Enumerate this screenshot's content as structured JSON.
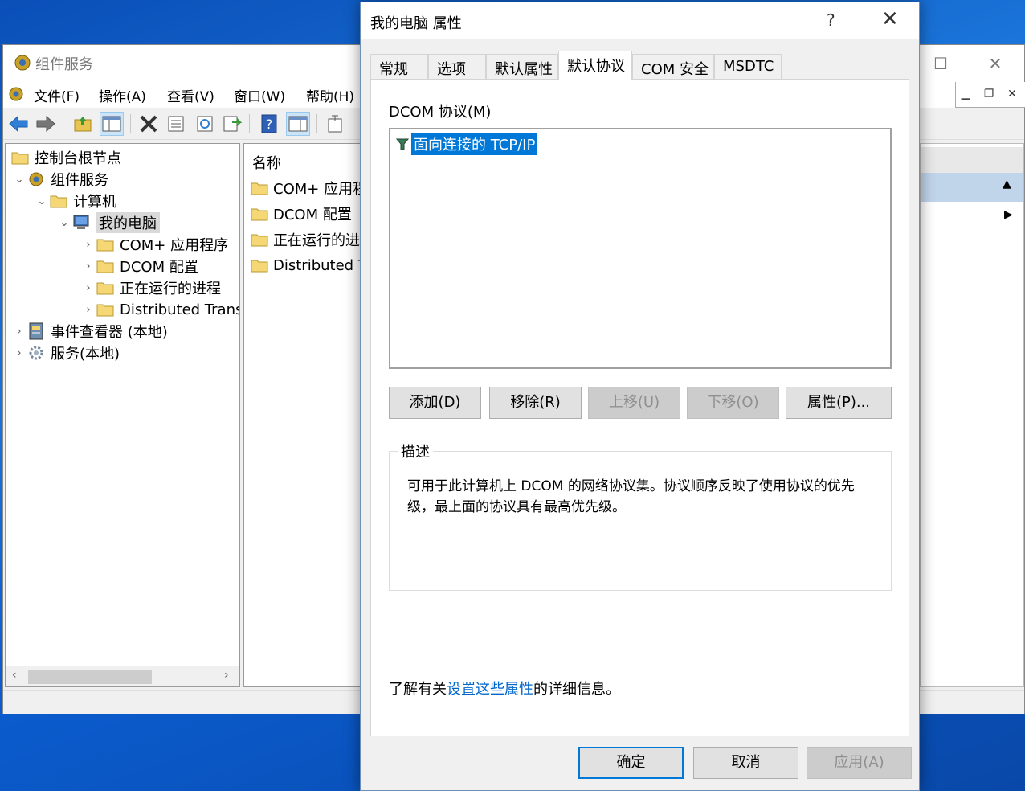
{
  "mmc": {
    "title": "组件服务",
    "menu": [
      "文件(F)",
      "操作(A)",
      "查看(V)",
      "窗口(W)",
      "帮助(H)"
    ],
    "tree": {
      "root": "控制台根节点",
      "component_services": "组件服务",
      "computers": "计算机",
      "my_computer": "我的电脑",
      "com_apps": "COM+ 应用程序",
      "dcom_config": "DCOM 配置",
      "running_processes": "正在运行的进程",
      "distributed_trans": "Distributed Trans",
      "event_viewer": "事件查看器 (本地)",
      "services": "服务(本地)"
    },
    "list": {
      "header": "名称",
      "items": [
        "COM+ 应用程",
        "DCOM 配置",
        "正在运行的进程",
        "Distributed Tr"
      ]
    }
  },
  "dialog": {
    "title": "我的电脑 属性",
    "help_glyph": "?",
    "close_glyph": "✕",
    "tabs": [
      "常规",
      "选项",
      "默认属性",
      "默认协议",
      "COM 安全",
      "MSDTC"
    ],
    "active_tab": "默认协议",
    "protocol_label": "DCOM 协议(M)",
    "protocols": [
      "面向连接的 TCP/IP"
    ],
    "buttons": {
      "add": "添加(D)",
      "remove": "移除(R)",
      "move_up": "上移(U)",
      "move_down": "下移(O)",
      "properties": "属性(P)..."
    },
    "description": {
      "legend": "描述",
      "text": "可用于此计算机上 DCOM 的网络协议集。协议顺序反映了使用协议的优先级，最上面的协议具有最高优先级。"
    },
    "learn_more": {
      "prefix": "了解有关",
      "link": "设置这些属性",
      "suffix": "的详细信息。"
    },
    "footer": {
      "ok": "确定",
      "cancel": "取消",
      "apply": "应用(A)"
    }
  },
  "colors": {
    "accent": "#0078d7",
    "link": "#0066cc",
    "desktop": "#0b5ccf"
  }
}
